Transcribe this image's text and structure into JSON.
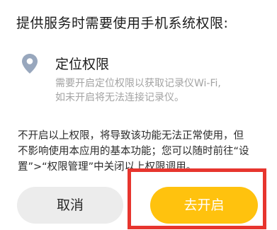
{
  "dialog": {
    "title": "提供服务时需要使用手机系统权限:"
  },
  "permission": {
    "icon": "location-pin-icon",
    "name": "定位权限",
    "desc_line1": "需要开启定位权限以获取记录仪Wi-Fi,",
    "desc_line2": "如未开启将无法连接记录仪。"
  },
  "notice": {
    "line1": "不开启以上权限，将导致该功能无法正常使用，但",
    "line2": "不影响使用本应用的基本功能；您可以随时前往“设",
    "line3": "置”>“权限管理”中关闭以上权限调用。"
  },
  "buttons": {
    "cancel_label": "取消",
    "confirm_label": "去开启"
  },
  "colors": {
    "accent": "#ffc20e",
    "highlight": "#e7352e",
    "icon": "#98a7bd"
  }
}
